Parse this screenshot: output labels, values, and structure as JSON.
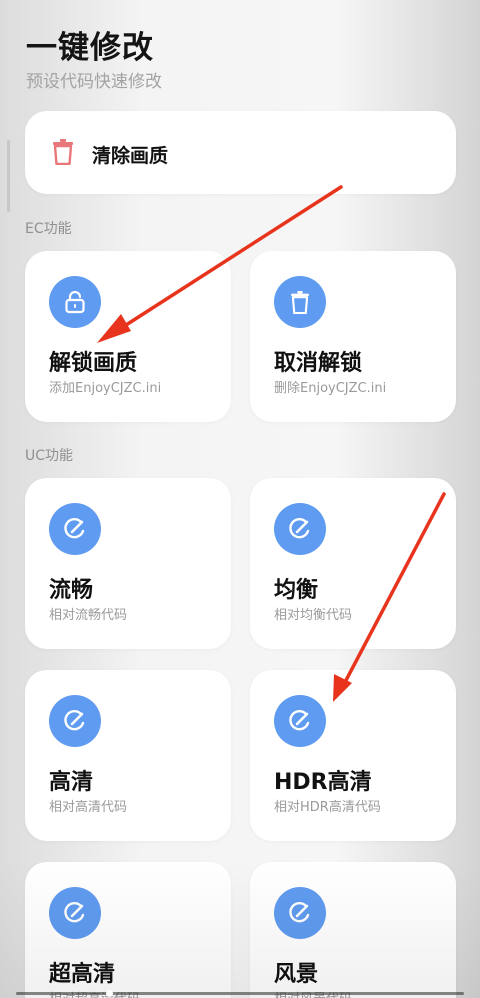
{
  "header": {
    "title": "一键修改",
    "subtitle": "预设代码快速修改"
  },
  "clear_card": {
    "label": "清除画质",
    "icon": "trash-icon"
  },
  "sections": {
    "ec_label": "EC功能",
    "uc_label": "UC功能"
  },
  "ec_cards": [
    {
      "name": "解锁画质",
      "desc": "添加EnjoyCJZC.ini",
      "icon": "lock-icon"
    },
    {
      "name": "取消解锁",
      "desc": "删除EnjoyCJZC.ini",
      "icon": "trash-icon"
    }
  ],
  "uc_cards": [
    {
      "name": "流畅",
      "desc": "相对流畅代码",
      "icon": "edit-icon"
    },
    {
      "name": "均衡",
      "desc": "相对均衡代码",
      "icon": "edit-icon"
    },
    {
      "name": "高清",
      "desc": "相对高清代码",
      "icon": "edit-icon"
    },
    {
      "name": "HDR高清",
      "desc": "相对HDR高清代码",
      "icon": "edit-icon"
    },
    {
      "name": "超高清",
      "desc": "相对超高清代码",
      "icon": "edit-icon"
    },
    {
      "name": "风景",
      "desc": "相对风景代码",
      "icon": "edit-icon"
    }
  ],
  "colors": {
    "accent_blue": "#5f9bf0",
    "trash_red": "#e8777a",
    "annotation_arrow": "#e8341c"
  }
}
